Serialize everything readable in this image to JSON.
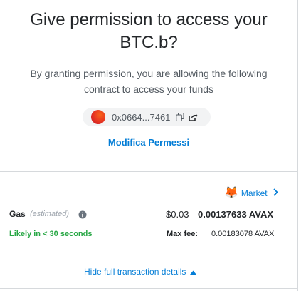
{
  "header": {
    "title_line1": "Give permission to access your",
    "title_line2": "BTC.b?"
  },
  "description": "By granting permission, you are allowing the following contract to access your funds",
  "contract": {
    "address_short": "0x0664...7461",
    "avatar_colors": [
      "#f7641b",
      "#ea3a20",
      "#c3152b"
    ]
  },
  "edit_permission_label": "Modifica Permessi",
  "market": {
    "icon": "metamask-fox-icon",
    "label": "Market"
  },
  "gas": {
    "label": "Gas",
    "estimated_label": "(estimated)",
    "fiat": "$0.03",
    "native": "0.00137633 AVAX",
    "likely_text": "Likely in < 30 seconds",
    "max_fee_label": "Max fee:",
    "max_fee_value": "0.00183078 AVAX"
  },
  "hide_details_label": "Hide full transaction details",
  "colors": {
    "link": "#037dd6",
    "success": "#28a745",
    "text": "#24272a",
    "muted": "#9fa6ae"
  }
}
